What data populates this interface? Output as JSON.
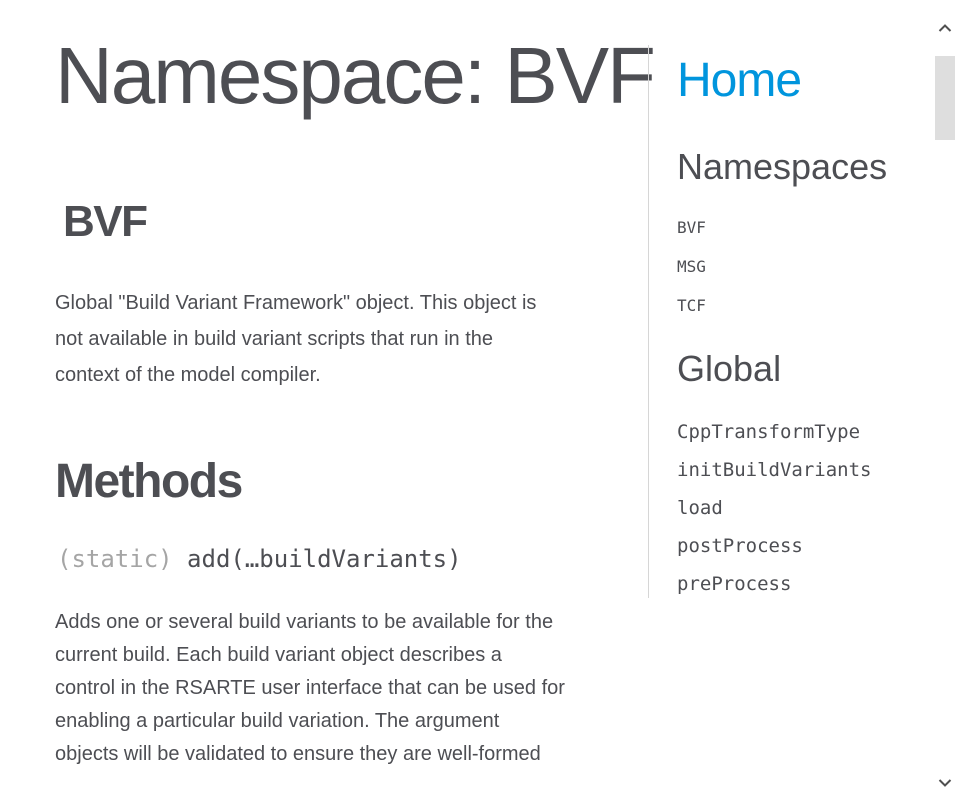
{
  "main": {
    "title": "Namespace: BVF",
    "subtitle": "BVF",
    "description": "Global \"Build Variant Framework\" object. This object is not available in build variant scripts that run in the context of the model compiler.",
    "methods_heading": "Methods",
    "method": {
      "modifier": "(static)",
      "signature": "add(…buildVariants)",
      "description": "Adds one or several build variants to be available for the current build. Each build variant object describes a control in the RSARTE user interface that can be used for enabling a particular build variation. The argument objects will be validated to ensure they are well-formed"
    }
  },
  "nav": {
    "home": "Home",
    "namespaces_heading": "Namespaces",
    "namespaces": [
      "BVF",
      "MSG",
      "TCF"
    ],
    "global_heading": "Global",
    "global": [
      "CppTransformType",
      "initBuildVariants",
      "load",
      "postProcess",
      "preProcess"
    ]
  },
  "colors": {
    "link": "#0095dd",
    "text": "#4d4e53",
    "muted": "#a5a5a5"
  },
  "icons": {
    "scroll_up": "chevron-up-icon",
    "scroll_down": "chevron-down-icon"
  }
}
